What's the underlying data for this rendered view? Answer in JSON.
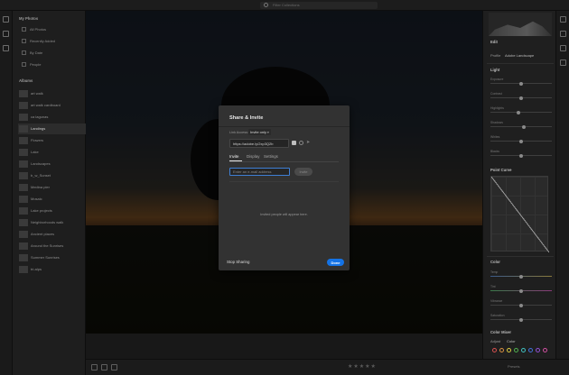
{
  "topbar": {
    "search_placeholder": "Filter Collections"
  },
  "sidebar": {
    "section_title": "My Photos",
    "nav": [
      {
        "label": "All Photos",
        "count": ""
      },
      {
        "label": "Recently Added",
        "count": ""
      },
      {
        "label": "By Date",
        "count": ""
      },
      {
        "label": "People",
        "count": ""
      }
    ],
    "albums_title": "Albums",
    "albums": [
      {
        "label": "art walk",
        "count": ""
      },
      {
        "label": "art walk cardboard",
        "count": ""
      },
      {
        "label": "ca lagunas",
        "count": ""
      },
      {
        "label": "Landings",
        "count": ""
      },
      {
        "label": "Flowers",
        "count": ""
      },
      {
        "label": "Lake",
        "count": ""
      },
      {
        "label": "Landscapes",
        "count": ""
      },
      {
        "label": "b_w_Sunset",
        "count": ""
      },
      {
        "label": "Medina pier",
        "count": ""
      },
      {
        "label": "Mosaic",
        "count": ""
      },
      {
        "label": "Lake projects",
        "count": ""
      },
      {
        "label": "Neighborhoods walk",
        "count": ""
      },
      {
        "label": "Ancient places",
        "count": ""
      },
      {
        "label": "Around the Sunrises",
        "count": ""
      },
      {
        "label": "Summer Sunrises",
        "count": ""
      },
      {
        "label": "tri-alps",
        "count": ""
      }
    ]
  },
  "rpanel": {
    "edit_label": "Edit",
    "profile_label": "Profile",
    "profile_value": "Adobe Landscape",
    "light_title": "Light",
    "light_sliders": [
      {
        "label": "Exposure",
        "value": 0.5
      },
      {
        "label": "Contrast",
        "value": 0.5
      },
      {
        "label": "Highlights",
        "value": 0.45
      },
      {
        "label": "Shadows",
        "value": 0.55
      },
      {
        "label": "Whites",
        "value": 0.5
      },
      {
        "label": "Blacks",
        "value": 0.5
      }
    ],
    "curve_title": "Point Curve",
    "color_title": "Color",
    "color_sliders": [
      {
        "label": "Temp",
        "value": 0.5
      },
      {
        "label": "Tint",
        "value": 0.5
      },
      {
        "label": "Vibrance",
        "value": 0.5
      },
      {
        "label": "Saturation",
        "value": 0.5
      }
    ],
    "mixer_title": "Color Mixer",
    "mixer_label": "Adjust",
    "mixer_value": "Color",
    "swatches": [
      "#d85050",
      "#d89040",
      "#d8c840",
      "#50b050",
      "#40c0c0",
      "#4070d8",
      "#9050d0",
      "#d050a0"
    ]
  },
  "bottombar": {
    "stars": "★★★★★",
    "presets": "Presets"
  },
  "modal": {
    "title": "Share & Invite",
    "access_label": "Link Access:",
    "access_value": "Invite only",
    "link_value": "https://adobe.ly/2xp3Q2b",
    "tabs": [
      "Invite",
      "Display",
      "Settings"
    ],
    "invite_placeholder": "Enter an e-mail address",
    "invite_button": "Invite",
    "empty_text": "Invited people will appear here.",
    "stop_sharing": "Stop Sharing",
    "done": "Done"
  }
}
